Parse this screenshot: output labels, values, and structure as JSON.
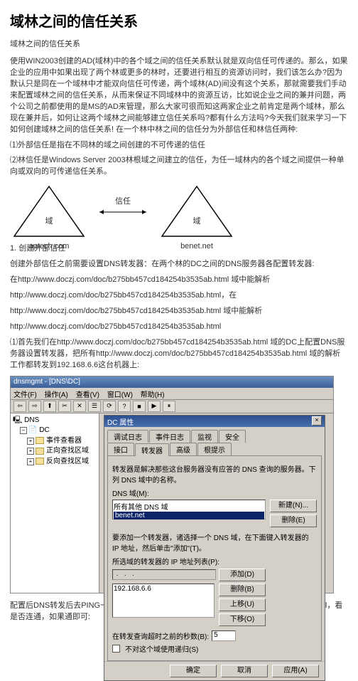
{
  "title": "域林之间的信任关系",
  "subtitle": "域林之间的信任关系",
  "intro": "使用WIN2003创建的AD(域林)中的各个域之间的信任关系默认就是双向信任可传递的。那么，如果企业的应用中如果出现了两个林或更多的林时，还要进行相互的资源访问时，我们该怎么办?因为默认只是同在一个域林中才能双向信任可传递，两个域林(AD)间没有这个关系，那就需要我们手动来配置域林之间的信任关系，从而来保证不同域林中的资源互访，比如说企业之间的兼并问题，两个公司之前都使用的是MS的AD来管理，那么大家可很而知这两家企业之前肯定是两个域林，那么现在兼并后，如何让这两个域林之间能够建立信任关系吗?都有什么方法吗?今天我们就来学习一下如何创建域林之间的信任关系! 在一个林中林之间的信任分为外部信任和林信任两种:",
  "item1": "⑴外部信任是指在不同林的域之间创建的不可传递的信任",
  "item2": "⑵林信任是Windows Server 2003林根域之间建立的信任，为任一域林内的各个域之间提供一种单向或双向的可传递信任关系。",
  "diagram": {
    "left_label": "域",
    "left_caption": "aptech.com",
    "arrow_label": "信任",
    "right_label": "域",
    "right_caption": "benet.net"
  },
  "sec1_title": "1. 创建外部信任",
  "sec1_p1": "创建外部信任之前需要设置DNS转发器：在两个林的DC之间的DNS服务器各配置转发器:",
  "links": {
    "l1": "在http://www.doczj.com/doc/b275bb457cd184254b3535ab.html 域中能解析",
    "l2": "http://www.doczj.com/doc/b275bb457cd184254b3535ab.html，在",
    "l3": "http://www.doczj.com/doc/b275bb457cd184254b3535ab.html 域中能解析",
    "l4": "http://www.doczj.com/doc/b275bb457cd184254b3535ab.html"
  },
  "step1": "⑴首先我们在http://www.doczj.com/doc/b275bb457cd184254b3535ab.html 域的DC上配置DNS服务器设置转发器，把所有http://www.doczj.com/doc/b275bb457cd184254b3535ab.html 域的解析工作都转发到192.168.6.6这台机器上:",
  "screenshot": {
    "title": "dnsmgmt - [DNS\\DC]",
    "menu": {
      "m1": "文件(F)",
      "m2": "操作(A)",
      "m3": "查看(V)",
      "m4": "窗口(W)",
      "m5": "帮助(H)"
    },
    "tree": {
      "root": "DNS",
      "dc": "DC",
      "n1": "事件查看器",
      "n2": "正向查找区域",
      "n3": "反向查找区域"
    },
    "dlg": {
      "title": "DC 属性",
      "close": "?  ×",
      "tabs": {
        "t1": "接口",
        "t2": "转发器",
        "t3": "高级",
        "t4": "根提示",
        "t5": "调试日志",
        "t6": "事件日志",
        "t7": "监视",
        "t8": "安全"
      },
      "desc": "转发器是解决那些这台服务器没有应答的 DNS 查询的服务器。下列 DNS 域中的名称。",
      "dns_label": "DNS 域(M):",
      "domains": {
        "d1": "所有其他 DNS 域",
        "d2": "benet.net"
      },
      "btn_new": "新建(N)...",
      "btn_del": "删除(E)",
      "fwd_desc": "要添加一个转发器，诸选择一个 DNS 域，在下面键入转发器的 IP 地址，然后单击\"添加\"(T)。",
      "ip_label": "所选域的转发器的 IP 地址列表(P):",
      "btn_add": "添加(D)",
      "btn_remove": "删除(B)",
      "btn_up": "上移(U)",
      "btn_down": "下移(O)",
      "ip_value": "192.168.6.6",
      "timeout_lbl": "在转发查询超时之前的秒数(B):",
      "timeout_val": "5",
      "chk_lbl": "不对这个域使用递归(S)",
      "ok": "确定",
      "cancel": "取消",
      "apply": "应用(A)"
    }
  },
  "footer": "配置后DNS转发后去PING一下http://www.doczj.com/doc/b275bb457cd184254b3535ab.html，看是否连通，如果通即可:"
}
